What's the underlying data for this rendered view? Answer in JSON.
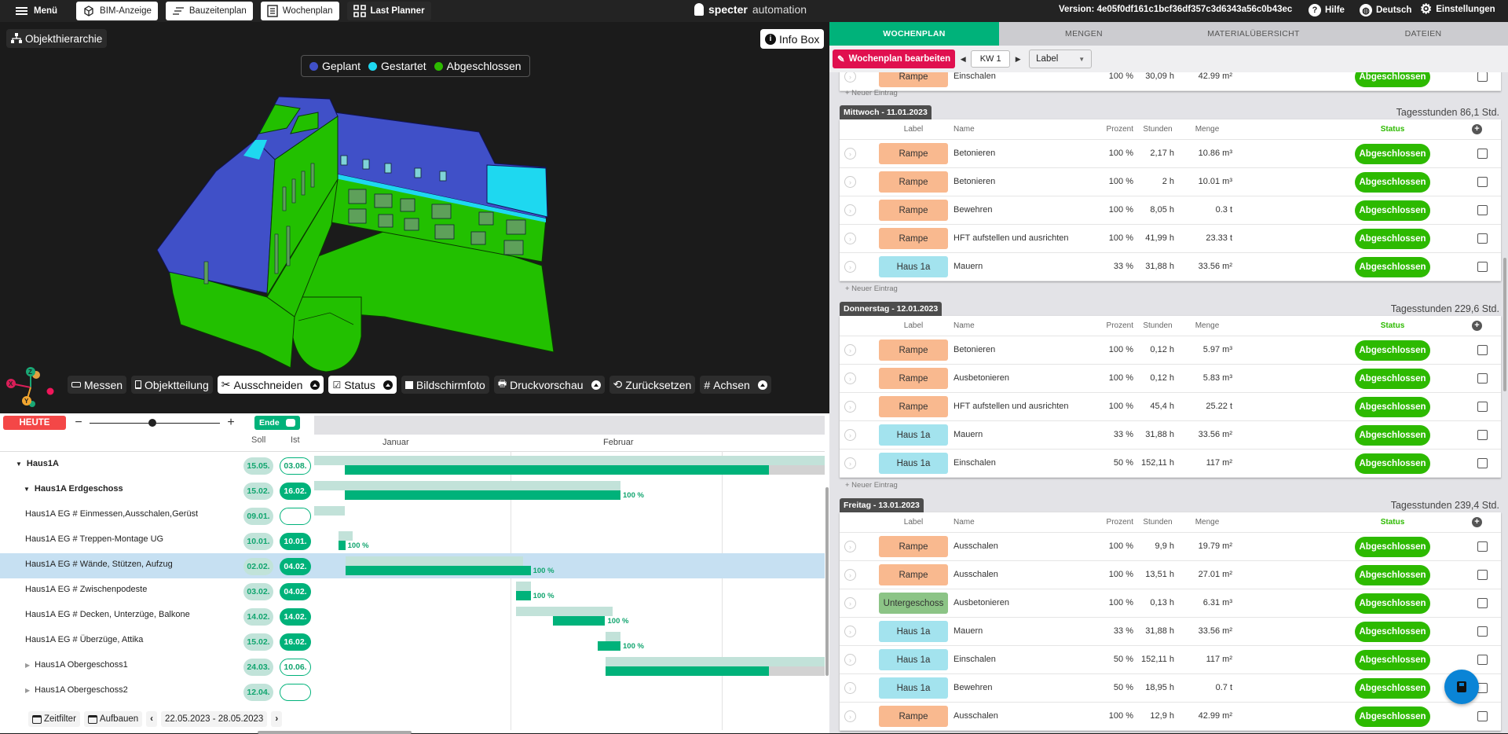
{
  "topbar": {
    "menu_label": "Menü",
    "tabs": [
      {
        "label": "BIM-Anzeige",
        "icon": "cube-icon"
      },
      {
        "label": "Bauzeitenplan",
        "icon": "lines-icon"
      },
      {
        "label": "Wochenplan",
        "icon": "list-icon"
      },
      {
        "label": "Last Planner",
        "icon": "grid-icon"
      }
    ],
    "brand_bold": "specter",
    "brand_light": "automation",
    "version": "Version: 4e05f0df161c1bcf36df357c3d6343a56c0b43ec",
    "help": "Hilfe",
    "language": "Deutsch",
    "settings": "Einstellungen"
  },
  "viewer": {
    "object_hierarchy": "Objekthierarchie",
    "info_box": "Info Box",
    "legend": [
      {
        "label": "Geplant",
        "color": "#4050c8"
      },
      {
        "label": "Gestartet",
        "color": "#1ed8f0"
      },
      {
        "label": "Abgeschlossen",
        "color": "#2dba00"
      }
    ],
    "axes": {
      "x": "X",
      "y": "Y",
      "z": "Z"
    },
    "tools": [
      {
        "label": "Messen",
        "dropdown": false,
        "white": false
      },
      {
        "label": "Objektteilung",
        "dropdown": false,
        "white": false
      },
      {
        "label": "Ausschneiden",
        "dropdown": true,
        "white": true
      },
      {
        "label": "Status",
        "dropdown": true,
        "white": true
      },
      {
        "label": "Bildschirmfoto",
        "dropdown": false,
        "white": false
      },
      {
        "label": "Druckvorschau",
        "dropdown": true,
        "white": false
      },
      {
        "label": "Zurücksetzen",
        "dropdown": false,
        "white": false
      },
      {
        "label": "Achsen",
        "dropdown": true,
        "white": false
      }
    ]
  },
  "gantt": {
    "today_label": "HEUTE",
    "end_toggle_label": "Ende",
    "col_soll": "Soll",
    "col_ist": "Ist",
    "months": [
      "Januar",
      "Februar"
    ],
    "rows": [
      {
        "name": "Haus1A",
        "level": 0,
        "expand": "open",
        "bold": true,
        "soll": "15.05.",
        "ist": "03.08.",
        "ist_style": "outline",
        "plan": [
          0.0,
          1.0
        ],
        "act": [
          0.06,
          0.89
        ],
        "rest": [
          0.89,
          1.0
        ],
        "pct": ""
      },
      {
        "name": "Haus1A Erdgeschoss",
        "level": 1,
        "expand": "open",
        "bold": true,
        "soll": "15.02.",
        "ist": "16.02.",
        "ist_style": "fill",
        "plan": [
          0.0,
          0.6
        ],
        "act": [
          0.06,
          0.6
        ],
        "pct": "100 %"
      },
      {
        "name": "Haus1A EG # Einmessen,Ausschalen,Gerüst",
        "level": 2,
        "expand": "",
        "bold": false,
        "soll": "09.01.",
        "ist": "",
        "ist_style": "outline",
        "plan": [
          0.0,
          0.06
        ],
        "pct": ""
      },
      {
        "name": "Haus1A EG # Treppen-Montage UG",
        "level": 2,
        "expand": "",
        "bold": false,
        "soll": "10.01.",
        "ist": "10.01.",
        "ist_style": "fill",
        "plan": [
          0.047,
          0.076
        ],
        "act": [
          0.047,
          0.061
        ],
        "pct": "100 %"
      },
      {
        "name": "Haus1A EG # Wände, Stützen, Aufzug",
        "level": 2,
        "expand": "",
        "bold": false,
        "soll": "02.02.",
        "ist": "04.02.",
        "ist_style": "fill",
        "selected": true,
        "plan": [
          0.061,
          0.41
        ],
        "act": [
          0.061,
          0.424
        ],
        "pct": "100 %"
      },
      {
        "name": "Haus1A EG # Zwischenpodeste",
        "level": 2,
        "expand": "",
        "bold": false,
        "soll": "03.02.",
        "ist": "04.02.",
        "ist_style": "fill",
        "plan": [
          0.395,
          0.424
        ],
        "act": [
          0.395,
          0.424
        ],
        "pct": "100 %"
      },
      {
        "name": "Haus1A EG # Decken, Unterzüge, Balkone",
        "level": 2,
        "expand": "",
        "bold": false,
        "soll": "14.02.",
        "ist": "14.02.",
        "ist_style": "fill",
        "plan": [
          0.395,
          0.585
        ],
        "act": [
          0.468,
          0.57
        ],
        "pct": "100 %"
      },
      {
        "name": "Haus1A EG # Überzüge, Attika",
        "level": 2,
        "expand": "",
        "bold": false,
        "soll": "15.02.",
        "ist": "16.02.",
        "ist_style": "fill",
        "plan": [
          0.57,
          0.6
        ],
        "act": [
          0.556,
          0.6
        ],
        "pct": "100 %"
      },
      {
        "name": "Haus1A Obergeschoss1",
        "level": 1,
        "expand": "closed",
        "bold": false,
        "soll": "24.03.",
        "ist": "10.06.",
        "ist_style": "outline",
        "plan": [
          0.57,
          1.0
        ],
        "act": [
          0.57,
          0.89
        ],
        "rest": [
          0.89,
          1.0
        ],
        "pct": ""
      },
      {
        "name": "Haus1A Obergeschoss2",
        "level": 1,
        "expand": "closed",
        "bold": false,
        "soll": "12.04.",
        "ist": "",
        "ist_style": "outline",
        "pct": ""
      }
    ],
    "footer": {
      "time_filter": "Zeitfilter",
      "build": "Aufbauen",
      "date_range": "22.05.2023 - 28.05.2023"
    }
  },
  "right": {
    "tabs": [
      "WOCHENPLAN",
      "MENGEN",
      "MATERIALÜBERSICHT",
      "DATEIEN"
    ],
    "active_tab": 0,
    "edit_button": "Wochenplan bearbeiten",
    "week": "KW 1",
    "label_select": "Label",
    "new_entry": "+ Neuer Eintrag",
    "columns": {
      "label": "Label",
      "name": "Name",
      "percent": "Prozent",
      "hours": "Stunden",
      "quantity": "Menge",
      "status": "Status"
    },
    "label_colors": {
      "Rampe": "#f9b98f",
      "Haus 1a": "#a3e3ee",
      "Untergeschoss": "#8cc486"
    },
    "partial_row": {
      "label": "Rampe",
      "name": "Einschalen",
      "percent": "100 %",
      "hours": "30,09 h",
      "qty": "42.99 m²",
      "status": "Abgeschlossen"
    },
    "days": [
      {
        "title": "Mittwoch - 11.01.2023",
        "total": "Tagesstunden 86,1 Std.",
        "rows": [
          {
            "label": "Rampe",
            "name": "Betonieren",
            "percent": "100 %",
            "hours": "2,17 h",
            "qty": "10.86 m³",
            "status": "Abgeschlossen"
          },
          {
            "label": "Rampe",
            "name": "Betonieren",
            "percent": "100 %",
            "hours": "2 h",
            "qty": "10.01 m³",
            "status": "Abgeschlossen"
          },
          {
            "label": "Rampe",
            "name": "Bewehren",
            "percent": "100 %",
            "hours": "8,05 h",
            "qty": "0.3 t",
            "status": "Abgeschlossen"
          },
          {
            "label": "Rampe",
            "name": "HFT aufstellen und ausrichten",
            "percent": "100 %",
            "hours": "41,99 h",
            "qty": "23.33 t",
            "status": "Abgeschlossen"
          },
          {
            "label": "Haus 1a",
            "name": "Mauern",
            "percent": "33 %",
            "hours": "31,88 h",
            "qty": "33.56 m²",
            "status": "Abgeschlossen"
          }
        ]
      },
      {
        "title": "Donnerstag - 12.01.2023",
        "total": "Tagesstunden 229,6 Std.",
        "rows": [
          {
            "label": "Rampe",
            "name": "Betonieren",
            "percent": "100 %",
            "hours": "0,12 h",
            "qty": "5.97 m³",
            "status": "Abgeschlossen"
          },
          {
            "label": "Rampe",
            "name": "Ausbetonieren",
            "percent": "100 %",
            "hours": "0,12 h",
            "qty": "5.83 m³",
            "status": "Abgeschlossen"
          },
          {
            "label": "Rampe",
            "name": "HFT aufstellen und ausrichten",
            "percent": "100 %",
            "hours": "45,4 h",
            "qty": "25.22 t",
            "status": "Abgeschlossen"
          },
          {
            "label": "Haus 1a",
            "name": "Mauern",
            "percent": "33 %",
            "hours": "31,88 h",
            "qty": "33.56 m²",
            "status": "Abgeschlossen"
          },
          {
            "label": "Haus 1a",
            "name": "Einschalen",
            "percent": "50 %",
            "hours": "152,11 h",
            "qty": "117 m²",
            "status": "Abgeschlossen"
          }
        ]
      },
      {
        "title": "Freitag - 13.01.2023",
        "total": "Tagesstunden 239,4 Std.",
        "rows": [
          {
            "label": "Rampe",
            "name": "Ausschalen",
            "percent": "100 %",
            "hours": "9,9 h",
            "qty": "19.79 m²",
            "status": "Abgeschlossen"
          },
          {
            "label": "Rampe",
            "name": "Ausschalen",
            "percent": "100 %",
            "hours": "13,51 h",
            "qty": "27.01 m²",
            "status": "Abgeschlossen"
          },
          {
            "label": "Untergeschoss",
            "name": "Ausbetonieren",
            "percent": "100 %",
            "hours": "0,13 h",
            "qty": "6.31 m³",
            "status": "Abgeschlossen"
          },
          {
            "label": "Haus 1a",
            "name": "Mauern",
            "percent": "33 %",
            "hours": "31,88 h",
            "qty": "33.56 m²",
            "status": "Abgeschlossen"
          },
          {
            "label": "Haus 1a",
            "name": "Einschalen",
            "percent": "50 %",
            "hours": "152,11 h",
            "qty": "117 m²",
            "status": "Abgeschlossen"
          },
          {
            "label": "Haus 1a",
            "name": "Bewehren",
            "percent": "50 %",
            "hours": "18,95 h",
            "qty": "0.7 t",
            "status": "Abgeschlossen"
          },
          {
            "label": "Rampe",
            "name": "Ausschalen",
            "percent": "100 %",
            "hours": "12,9 h",
            "qty": "42.99 m²",
            "status": "Abgeschlossen"
          }
        ]
      }
    ]
  }
}
